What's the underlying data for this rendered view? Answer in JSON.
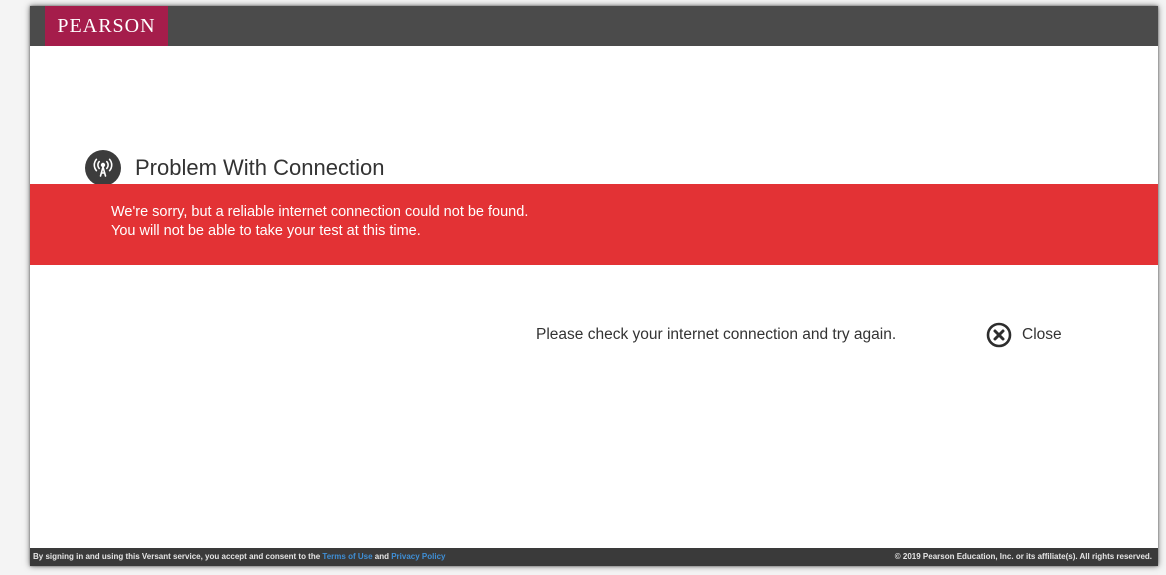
{
  "header": {
    "brand": "PEARSON",
    "brand_color": "#a51d4b",
    "bar_color": "#4b4b4b"
  },
  "dialog": {
    "icon": "wireless-signal-icon",
    "title": "Problem With Connection",
    "alert_color": "#e33235",
    "alert_line_1": "We're sorry, but a reliable internet connection could not be found.",
    "alert_line_2": "You will not be able to take your test at this time.",
    "check_message": "Please check your internet connection and try again.",
    "close_icon": "close-circle-icon",
    "close_label": "Close"
  },
  "footer": {
    "consent_prefix": "By signing in and using this Versant service, you accept and consent to the",
    "terms_link": "Terms of Use",
    "and_text": "and",
    "privacy_link": "Privacy Policy",
    "copyright": "© 2019 Pearson Education, Inc. or its affiliate(s). All rights reserved.",
    "link_color": "#3f8fd6"
  }
}
